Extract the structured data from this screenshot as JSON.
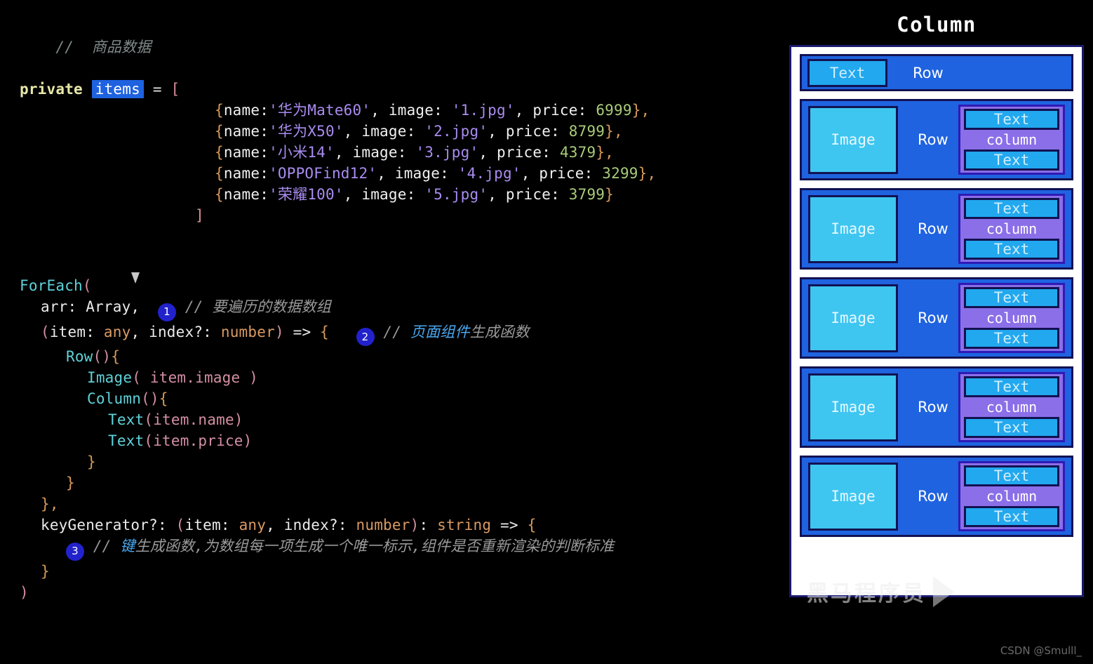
{
  "code": {
    "comment_data": "//  商品数据",
    "keyword_private": "private",
    "var_items": "items",
    "equals": "=",
    "open_bracket": "[",
    "close_bracket": "]",
    "items": [
      {
        "open": "{",
        "key_name": "name:",
        "name": "'华为Mate60'",
        "comma1": ",",
        "key_image": "image:",
        "image": "'1.jpg'",
        "comma2": ",",
        "key_price": "price:",
        "price": "6999",
        "close": "},"
      },
      {
        "open": "{",
        "key_name": "name:",
        "name": "'华为X50'",
        "comma1": ",",
        "key_image": "image:",
        "image": "'2.jpg'",
        "comma2": ",",
        "key_price": "price:",
        "price": "8799",
        "close": "},"
      },
      {
        "open": "{",
        "key_name": "name:",
        "name": "'小米14'",
        "comma1": ",",
        "key_image": "image:",
        "image": "'3.jpg'",
        "comma2": ",",
        "key_price": "price:",
        "price": "4379",
        "close": "},"
      },
      {
        "open": "{",
        "key_name": "name:",
        "name": "'OPPOFind12'",
        "comma1": ",",
        "key_image": "image:",
        "image": "'4.jpg'",
        "comma2": ",",
        "key_price": "price:",
        "price": "3299",
        "close": "},"
      },
      {
        "open": "{",
        "key_name": "name:",
        "name": "'荣耀100'",
        "comma1": ",",
        "key_image": "image:",
        "image": "'5.jpg'",
        "comma2": ",",
        "key_price": "price:",
        "price": "3799",
        "close": "}"
      }
    ],
    "foreach_name": "ForEach",
    "foreach_open_paren": "(",
    "arg_arr": "arr: Array,",
    "badge_1": "1",
    "comment_1_slashes": "//",
    "comment_1_text": "要遍历的数据数组",
    "callback_sig_paren_open": "(",
    "callback_item": "item:",
    "callback_any": "any",
    "callback_comma": ",",
    "callback_index": "index?:",
    "callback_number": "number",
    "callback_paren_close": ")",
    "callback_arrow": "=>",
    "callback_brace_open": "{",
    "badge_2": "2",
    "comment_2_slashes": "//",
    "comment_2_hi": "页面组件",
    "comment_2_rest": "生成函数",
    "row_call": "Row",
    "row_parens": "()",
    "row_brace": "{",
    "image_call": "Image",
    "image_arg": "( item.image )",
    "column_call": "Column",
    "column_parens": "()",
    "column_brace": "{",
    "text_name_call": "Text",
    "text_name_arg": "(item.name)",
    "text_price_call": "Text",
    "text_price_arg": "(item.price)",
    "close_brace_inner": "}",
    "close_brace_row": "}",
    "close_brace_comma": "},",
    "keygen_name": "keyGenerator?:",
    "keygen_paren_open": "(",
    "keygen_item": "item:",
    "keygen_any": "any",
    "keygen_comma": ",",
    "keygen_index": "index?:",
    "keygen_number": "number",
    "keygen_paren_close": ")",
    "keygen_colon": ":",
    "keygen_return": "string",
    "keygen_arrow": "=>",
    "keygen_brace": "{",
    "badge_3": "3",
    "comment_3_slashes": "//",
    "comment_3_hi": "键",
    "comment_3_rest": "生成函数,为数组每一项生成一个唯一标示,组件是否重新渲染的判断标准",
    "close_brace_keygen": "}",
    "close_foreach_paren": ")"
  },
  "diagram": {
    "title": "Column",
    "header_row": {
      "text_box": "Text",
      "row_label": "Row"
    },
    "rows": [
      {
        "image_label": "Image",
        "row_label": "Row",
        "column_label": "column",
        "text_top": "Text",
        "text_bottom": "Text"
      },
      {
        "image_label": "Image",
        "row_label": "Row",
        "column_label": "column",
        "text_top": "Text",
        "text_bottom": "Text"
      },
      {
        "image_label": "Image",
        "row_label": "Row",
        "column_label": "column",
        "text_top": "Text",
        "text_bottom": "Text"
      },
      {
        "image_label": "Image",
        "row_label": "Row",
        "column_label": "column",
        "text_top": "Text",
        "text_bottom": "Text"
      },
      {
        "image_label": "Image",
        "row_label": "Row",
        "column_label": "column",
        "text_top": "Text",
        "text_bottom": "Text"
      }
    ]
  },
  "watermarks": {
    "brand": "黑马程序员",
    "csdn": "CSDN @Smulll_"
  },
  "colors": {
    "background": "#000000",
    "highlight_blue": "#1f62e0",
    "badge_blue": "#2222cc",
    "row_card": "#1f63e0",
    "image_box": "#3ec6f0",
    "text_box": "#22a8ee",
    "column_box": "#8b6fe8",
    "container_border": "#1a1a6e"
  }
}
